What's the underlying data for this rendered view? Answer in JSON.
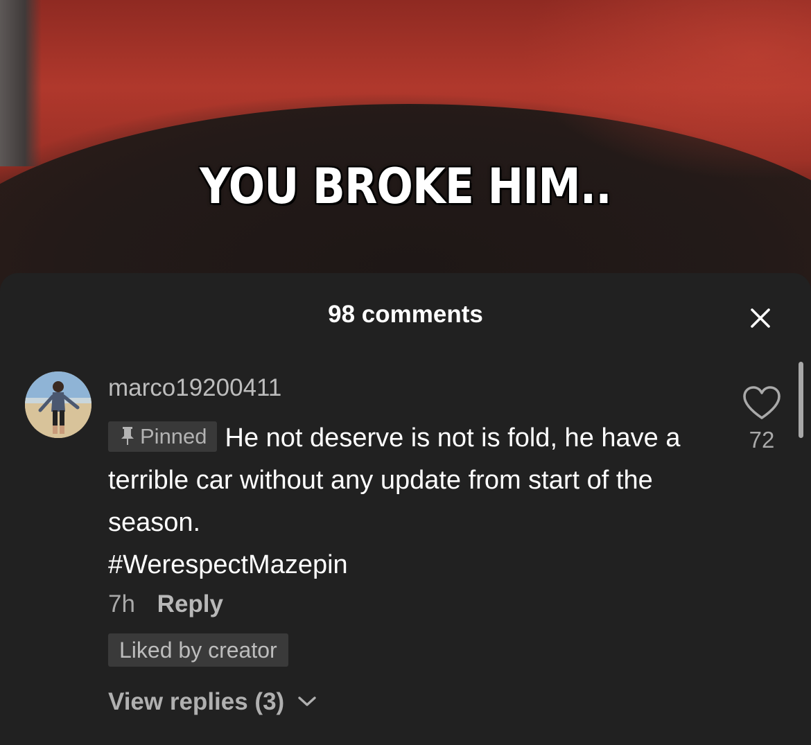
{
  "video": {
    "caption": "YOU BROKE HIM.."
  },
  "comments_sheet": {
    "title": "98 comments",
    "close_icon": "close-icon"
  },
  "comment": {
    "username": "marco19200411",
    "pinned_label": "Pinned",
    "text": "He not deserve is not is fold, he have a terrible car without any update from start of the season.",
    "hashtag": "#WerespectMazepin",
    "time": "7h",
    "reply_label": "Reply",
    "creator_badge": "Liked by creator",
    "view_replies_label": "View replies (3)",
    "like_count": "72"
  },
  "colors": {
    "sheet_background": "#212121",
    "primary_text": "#ffffff",
    "secondary_text": "#a9a9a9",
    "badge_background": "#393939"
  }
}
